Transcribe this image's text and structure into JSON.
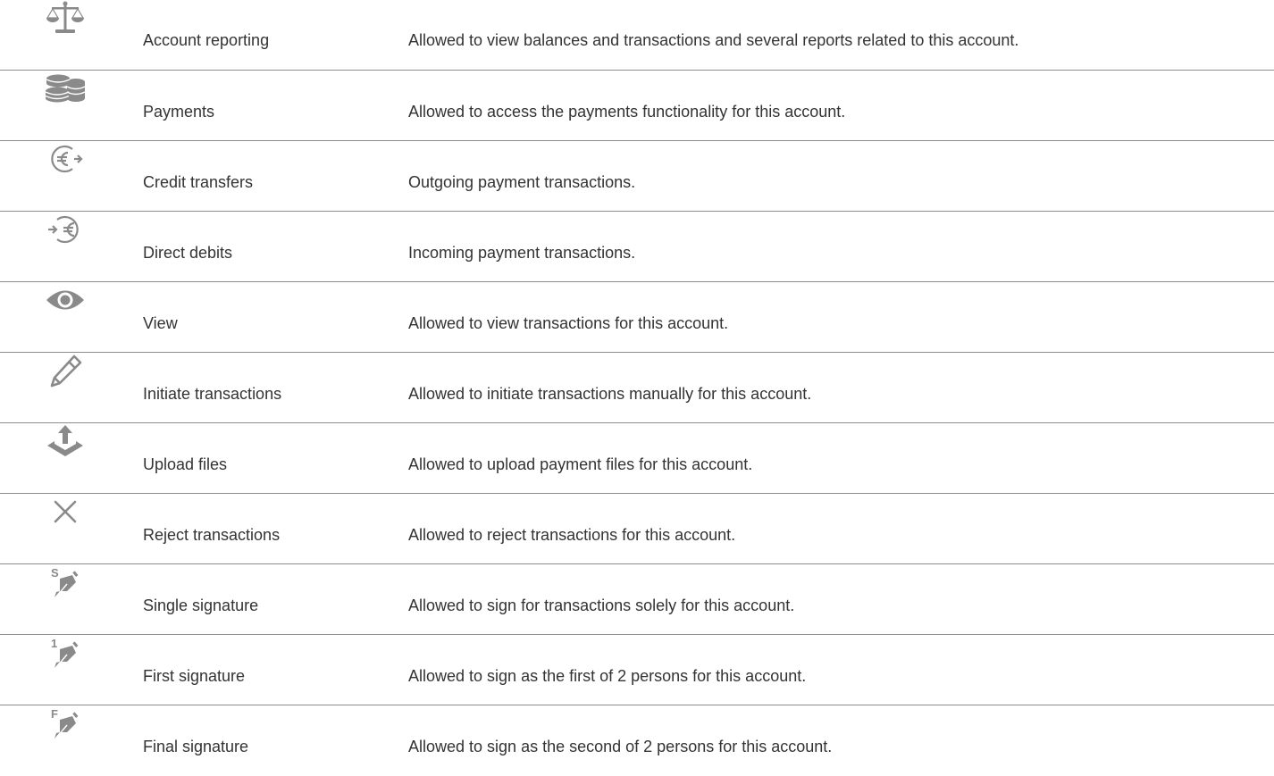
{
  "colors": {
    "icon": "#8a8a8a",
    "text": "#333333",
    "divider": "#8c8c8c"
  },
  "rights": [
    {
      "icon": "scales-icon",
      "label": "Account reporting",
      "description": "Allowed to view balances and transactions and several reports related to this account."
    },
    {
      "icon": "coins-icon",
      "label": "Payments",
      "description": "Allowed to access the payments functionality for this account."
    },
    {
      "icon": "euro-out-icon",
      "label": "Credit transfers",
      "description": "Outgoing payment transactions."
    },
    {
      "icon": "euro-in-icon",
      "label": "Direct debits",
      "description": "Incoming payment transactions."
    },
    {
      "icon": "eye-icon",
      "label": "View",
      "description": "Allowed to view transactions for this account."
    },
    {
      "icon": "pen-icon",
      "label": "Initiate transactions",
      "description": "Allowed to initiate transactions manually for this account."
    },
    {
      "icon": "upload-icon",
      "label": "Upload files",
      "description": "Allowed to upload payment files for this account."
    },
    {
      "icon": "close-icon",
      "label": "Reject transactions",
      "description": "Allowed to reject transactions for this account."
    },
    {
      "icon": "single-signature-icon",
      "icon_letter": "S",
      "label": "Single signature",
      "description": "Allowed to sign for transactions solely for this account."
    },
    {
      "icon": "first-signature-icon",
      "icon_letter": "1",
      "label": "First signature",
      "description": "Allowed to sign as the first of 2 persons for this account."
    },
    {
      "icon": "final-signature-icon",
      "icon_letter": "F",
      "label": "Final signature",
      "description": "Allowed to sign as the second of 2 persons for this account."
    }
  ]
}
